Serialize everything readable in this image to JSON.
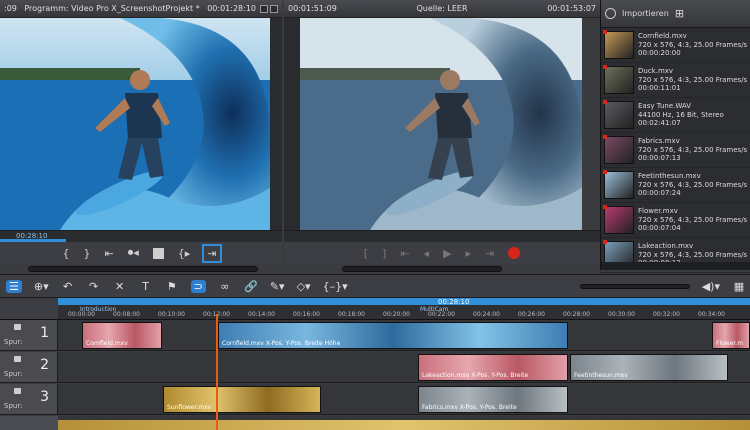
{
  "program_monitor": {
    "timecode_left": ":09",
    "title": "Programm: Video Pro X_ScreenshotProjekt *",
    "timecode_right": "00:01:28:10",
    "scrub_time": "00:28:10"
  },
  "source_monitor": {
    "timecode_left": "00:01:51:09",
    "title": "Quelle: LEER",
    "timecode_right": "00:01:53:07"
  },
  "program_controls": [
    "{",
    "}",
    "⇤",
    "⏺◂",
    "■",
    "{▸",
    "⇥"
  ],
  "source_controls": [
    "[",
    "]",
    "⇤",
    "◂",
    "▶",
    "▸",
    "⇥"
  ],
  "media_pool": {
    "header": "Importieren",
    "items": [
      {
        "name": "Cornfield.mxv",
        "info": "720 x 576, 4:3, 25.00 Frames/s",
        "duration": "00:00:20:00",
        "color": "#c69a55"
      },
      {
        "name": "Duck.mxv",
        "info": "720 x 576, 4:3, 25.00 Frames/s",
        "duration": "00:00:11:01",
        "color": "#6d6f5a"
      },
      {
        "name": "Easy Tune.WAV",
        "info": "44100 Hz, 16 Bit, Stereo",
        "duration": "00:02:41:07",
        "color": "#5a5b60"
      },
      {
        "name": "Fabrics.mxv",
        "info": "720 x 576, 4:3, 25.00 Frames/s",
        "duration": "00:00:07:13",
        "color": "#7a4a64"
      },
      {
        "name": "Feetinthesun.mxv",
        "info": "720 x 576, 4:3, 25.00 Frames/s",
        "duration": "00:00:07:24",
        "color": "#9ac0d8"
      },
      {
        "name": "Flower.mxv",
        "info": "720 x 576, 4:3, 25.00 Frames/s",
        "duration": "00:00:07:04",
        "color": "#b83a70"
      },
      {
        "name": "Lakeaction.mxv",
        "info": "720 x 576, 4:3, 25.00 Frames/s",
        "duration": "00:00:08:12",
        "color": "#7b9fba"
      }
    ]
  },
  "toolbar": [
    "☰",
    "⊕▾",
    "↶",
    "↷",
    "✕",
    "T",
    "⚑",
    "⊃",
    "∞",
    "🔗",
    "✎▾",
    "◇▾",
    "{–}▾"
  ],
  "toolbar_right": [
    "◀)▾",
    "▦"
  ],
  "ruler": {
    "center_label": "00:28:10",
    "markers": [
      "Introduction",
      "MultiCam"
    ],
    "ticks": [
      "00:00:00",
      "00:08:00",
      "00:10:00",
      "00:12:00",
      "00:14:00",
      "00:16:00",
      "00:18:00",
      "00:20:00",
      "00:22:00",
      "00:24:00",
      "00:26:00",
      "00:28:00",
      "00:30:00",
      "00:32:00",
      "00:34:00"
    ]
  },
  "tracks": [
    {
      "number": "1",
      "label": "Spur:",
      "clips": [
        {
          "name": "Cornfield.mxv",
          "style": "clipp"
        },
        {
          "name": "Cornfield.mxv  X-Pos.  Y-Pos.  Breite  Höhe",
          "style": "clipb"
        },
        {
          "name": "Flower.m",
          "style": "clipp"
        }
      ]
    },
    {
      "number": "2",
      "label": "Spur:",
      "clips": [
        {
          "name": "Lakeaction.mxv  X-Pos.  Y-Pos.  Breite",
          "style": "clipp"
        },
        {
          "name": "Feetinthesun.mxv",
          "style": "clipg"
        }
      ]
    },
    {
      "number": "3",
      "label": "Spur:",
      "clips": [
        {
          "name": "Sunflower.mxv",
          "style": "clipy"
        },
        {
          "name": "Fabrics.mxv  X-Pos.  Y-Pos.  Breite",
          "style": "clipg"
        }
      ]
    }
  ]
}
